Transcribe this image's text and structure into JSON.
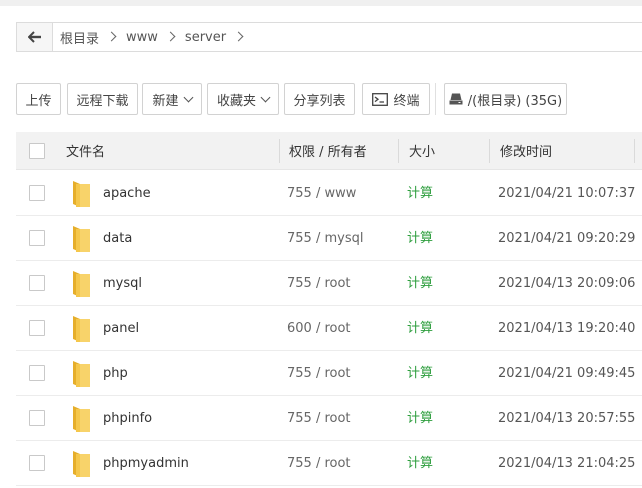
{
  "breadcrumb": {
    "back_icon": "back-arrow-icon",
    "items": [
      "根目录",
      "www",
      "server"
    ]
  },
  "toolbar": {
    "upload": "上传",
    "remote_download": "远程下载",
    "new": "新建",
    "favorites": "收藏夹",
    "share_list": "分享列表",
    "terminal": "终端",
    "disk": "/(根目录) (35G)"
  },
  "table": {
    "headers": {
      "name": "文件名",
      "permission": "权限 / 所有者",
      "size": "大小",
      "modified": "修改时间"
    },
    "rows": [
      {
        "name": "apache",
        "perm": "755 / www",
        "size": "计算",
        "time": "2021/04/21 10:07:37"
      },
      {
        "name": "data",
        "perm": "755 / mysql",
        "size": "计算",
        "time": "2021/04/21 09:20:29"
      },
      {
        "name": "mysql",
        "perm": "755 / root",
        "size": "计算",
        "time": "2021/04/13 20:09:06"
      },
      {
        "name": "panel",
        "perm": "600 / root",
        "size": "计算",
        "time": "2021/04/13 19:20:40"
      },
      {
        "name": "php",
        "perm": "755 / root",
        "size": "计算",
        "time": "2021/04/21 09:49:45"
      },
      {
        "name": "phpinfo",
        "perm": "755 / root",
        "size": "计算",
        "time": "2021/04/13 20:57:55"
      },
      {
        "name": "phpmyadmin",
        "perm": "755 / root",
        "size": "计算",
        "time": "2021/04/13 21:04:25"
      }
    ]
  },
  "colors": {
    "size_link": "#2e9e3e",
    "folder": "#f5c74b"
  }
}
